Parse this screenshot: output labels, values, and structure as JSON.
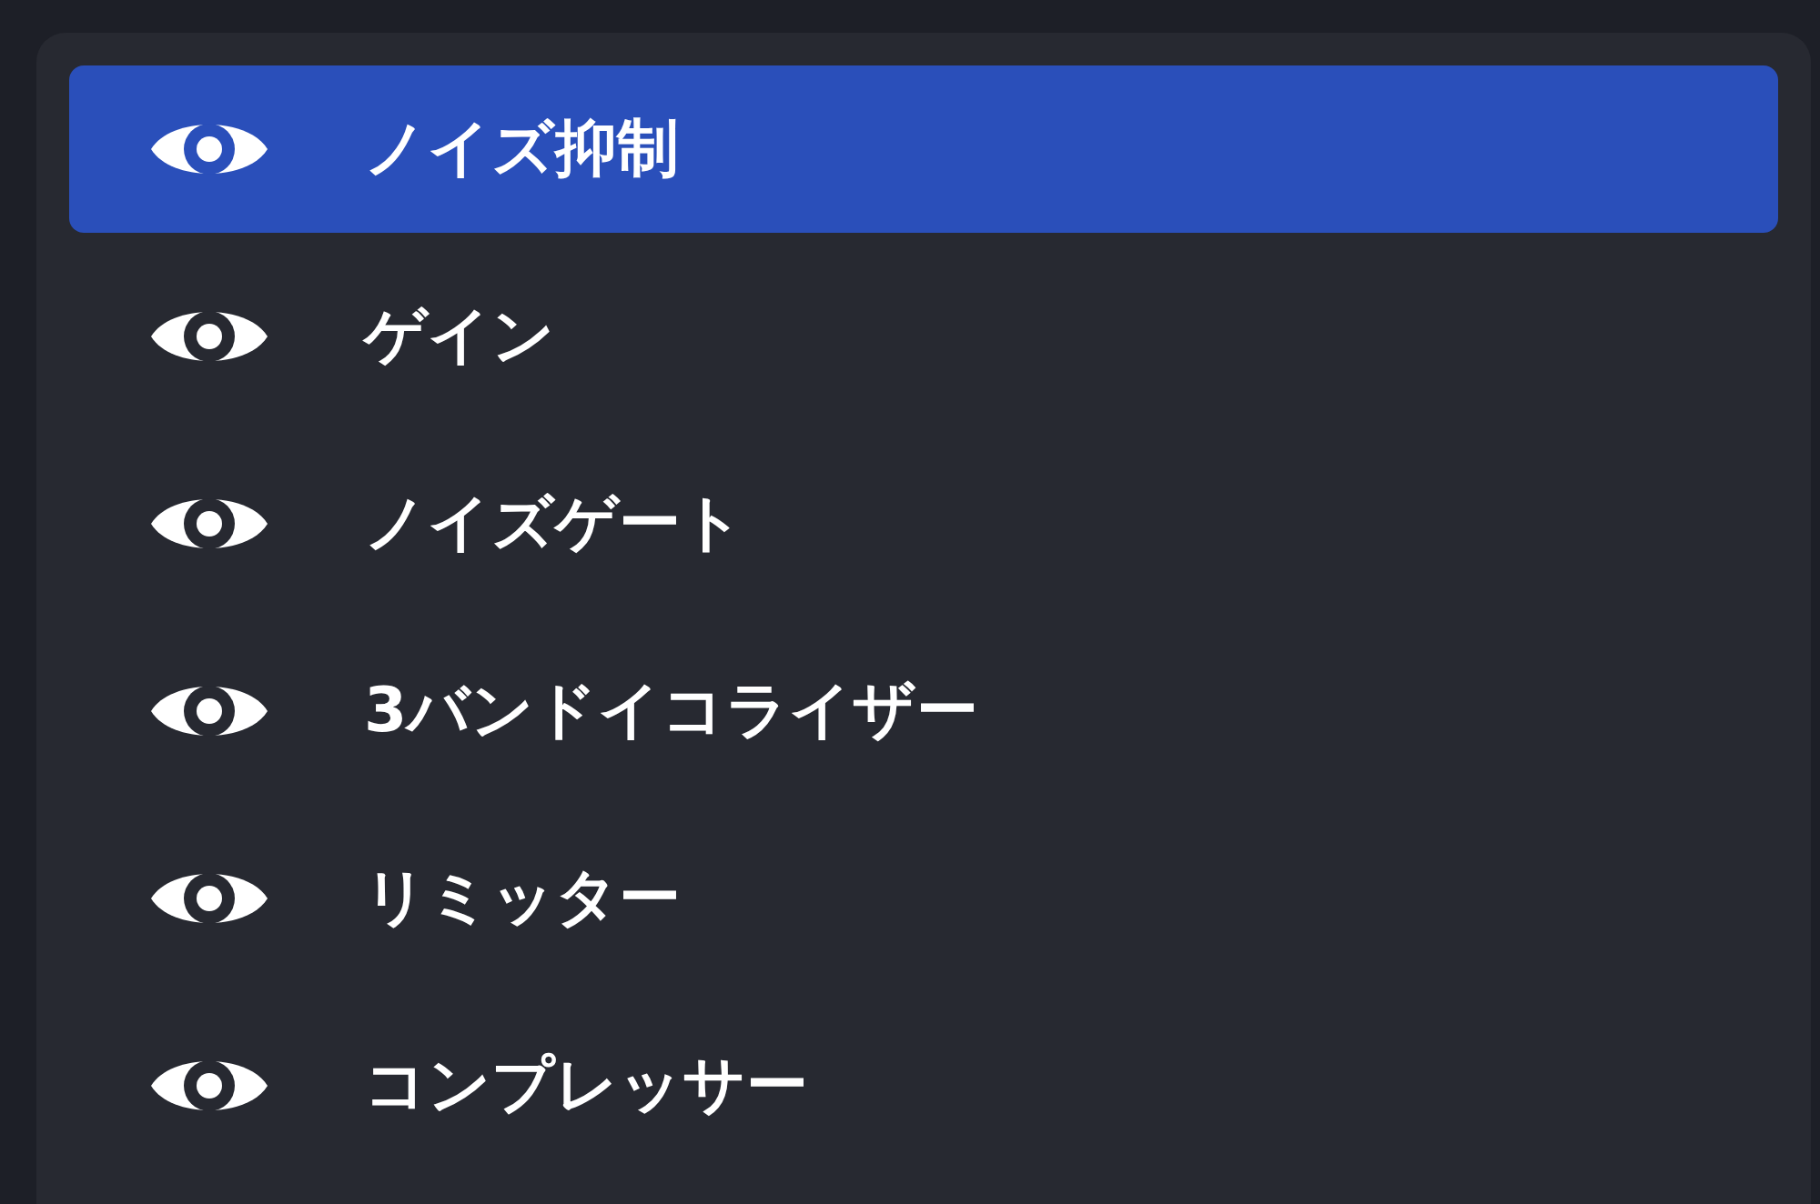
{
  "filters": [
    {
      "label": "ノイズ抑制",
      "visible": true,
      "selected": true
    },
    {
      "label": "ゲイン",
      "visible": true,
      "selected": false
    },
    {
      "label": "ノイズゲート",
      "visible": true,
      "selected": false
    },
    {
      "label": "3バンドイコライザー",
      "visible": true,
      "selected": false
    },
    {
      "label": "リミッター",
      "visible": true,
      "selected": false
    },
    {
      "label": "コンプレッサー",
      "visible": true,
      "selected": false
    }
  ]
}
